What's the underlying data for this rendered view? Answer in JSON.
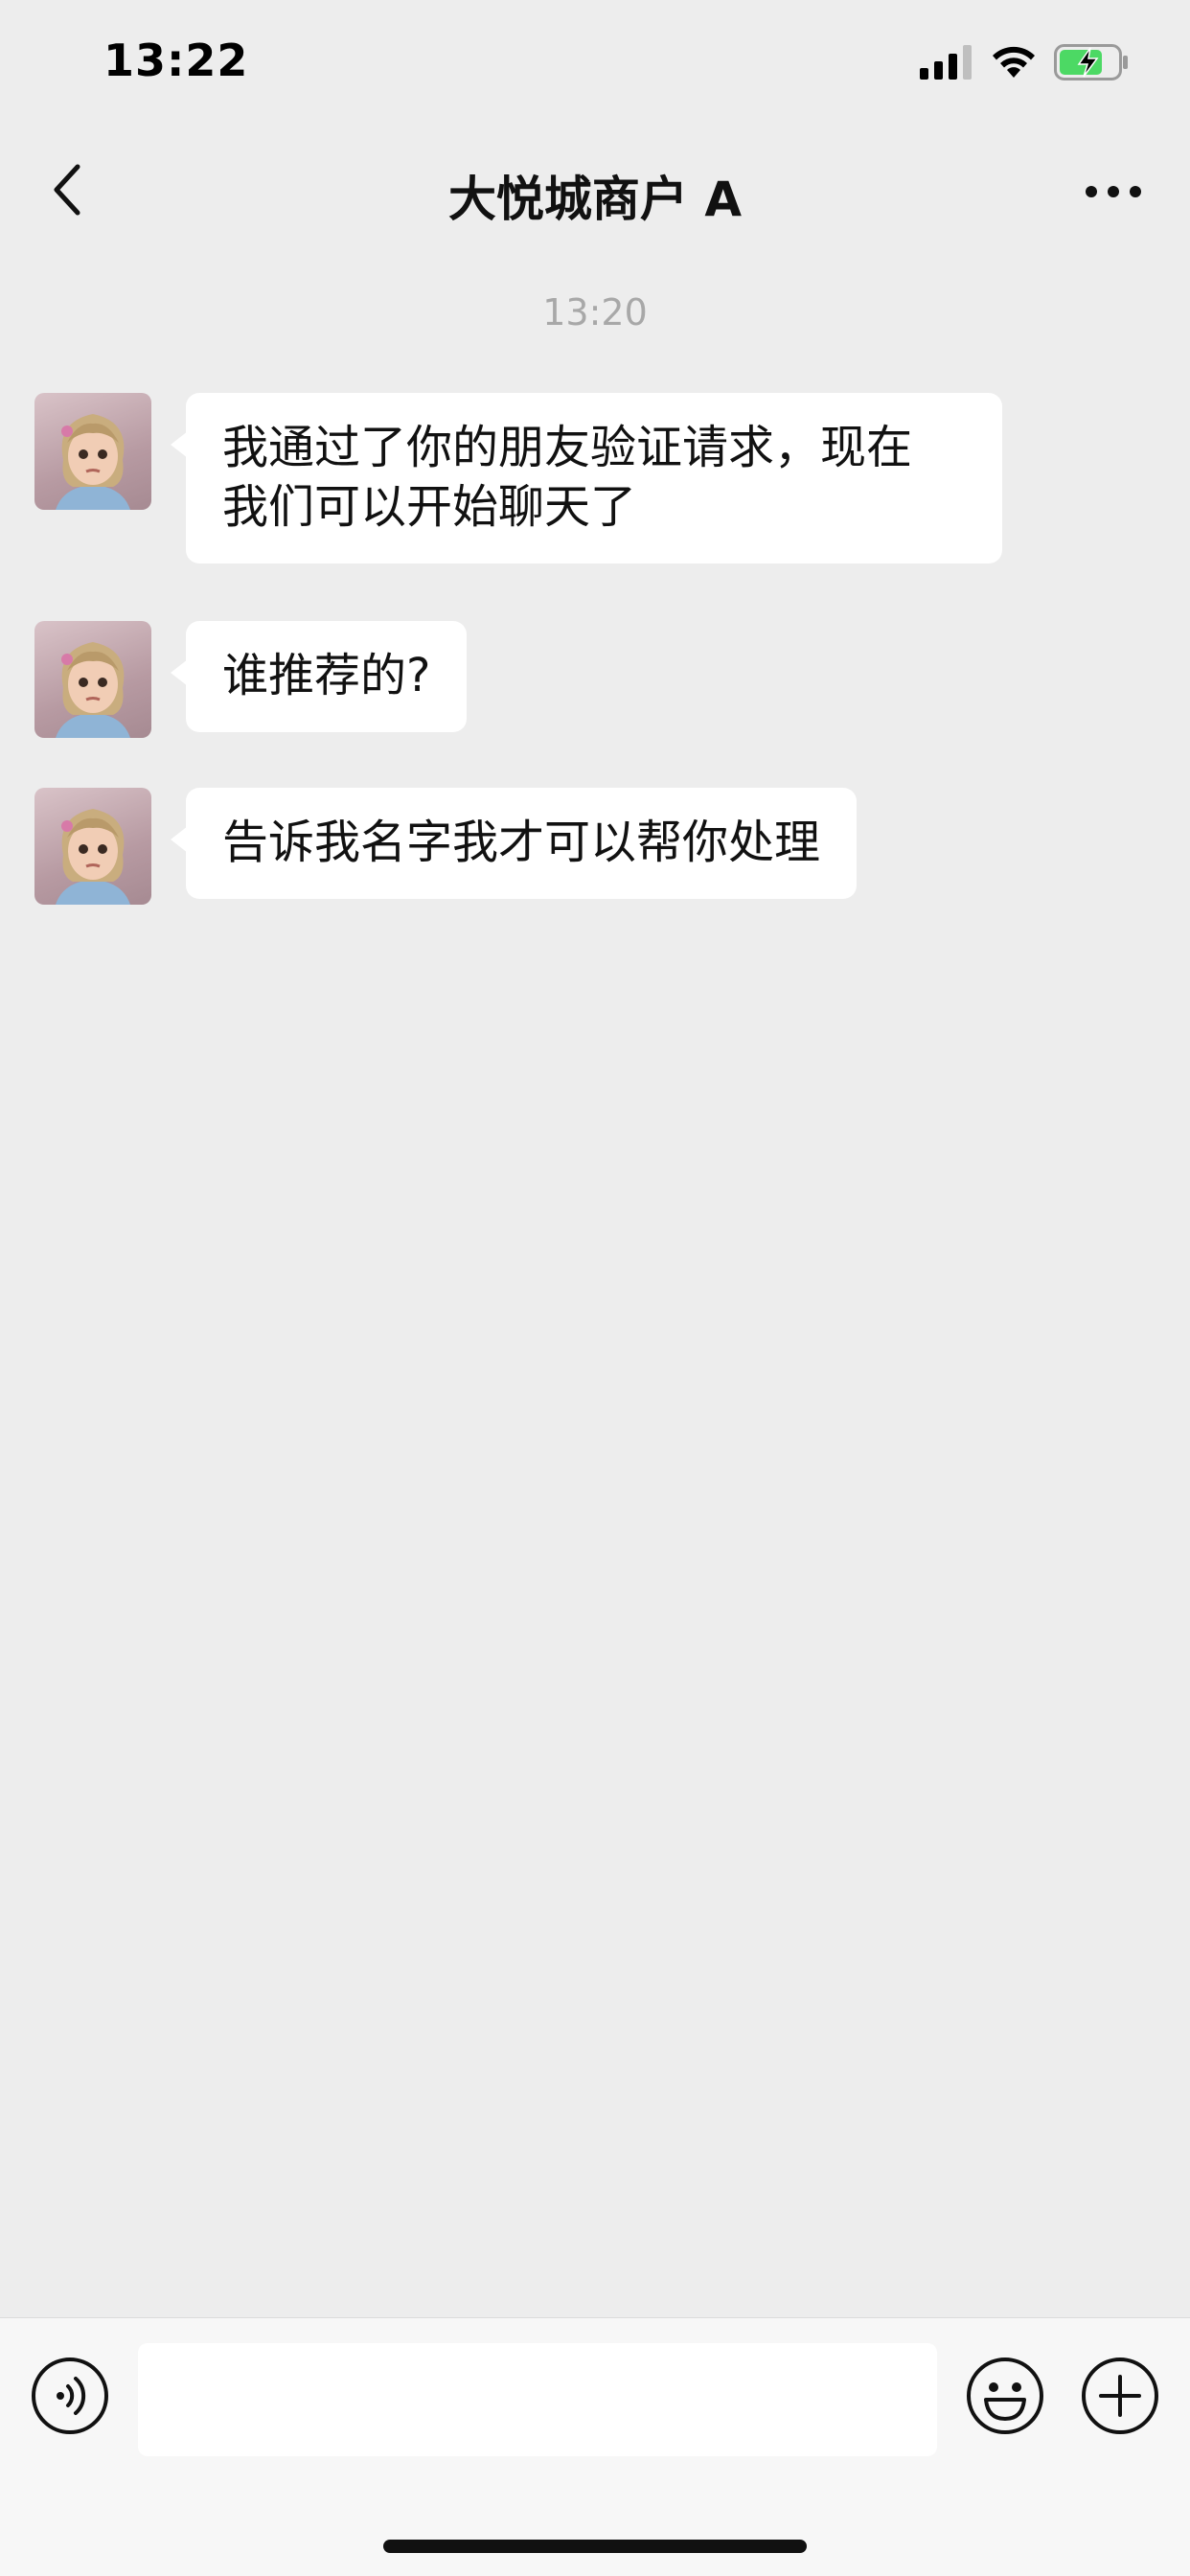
{
  "status_bar": {
    "time": "13:22",
    "icons": [
      "cellular-signal-icon",
      "wifi-icon",
      "battery-charging-icon"
    ],
    "battery_color": "#4cd964"
  },
  "nav": {
    "title": "大悦城商户 A",
    "back_icon": "chevron-left-icon",
    "more_icon": "more-dots-icon"
  },
  "chat": {
    "timestamp": "13:20",
    "messages": [
      {
        "sender": "received",
        "lines": [
          "我通过了你的朋友验证请求，现在",
          "我们可以开始聊天了"
        ]
      },
      {
        "sender": "received",
        "lines": [
          "谁推荐的?"
        ]
      },
      {
        "sender": "received",
        "lines": [
          "告诉我名字我才可以帮你处理"
        ]
      }
    ]
  },
  "input_bar": {
    "voice_icon": "voice-icon",
    "text_value": "",
    "emoji_icon": "emoji-icon",
    "plus_icon": "plus-icon"
  },
  "colors": {
    "background": "#ededed",
    "bubble": "#ffffff",
    "timestamp": "#a8a8a8",
    "input_bar": "#f7f7f7"
  }
}
